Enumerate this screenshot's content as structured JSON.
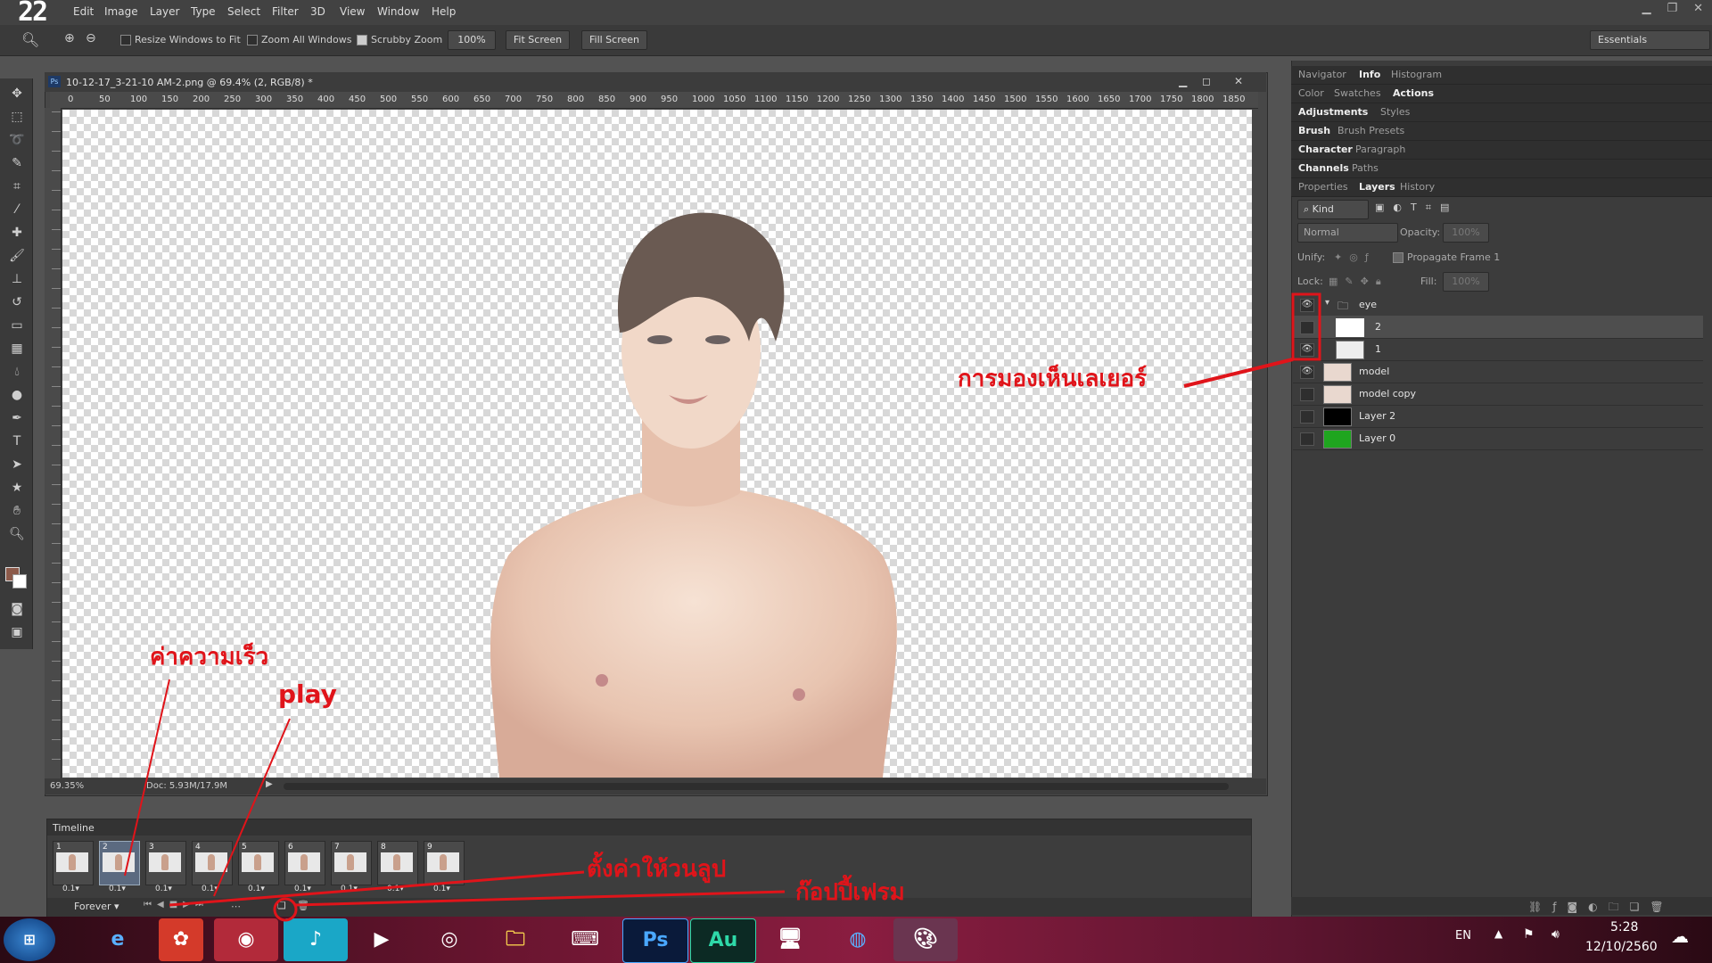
{
  "app": {
    "logo_text": "22",
    "menu": [
      "Edit",
      "Image",
      "Layer",
      "Type",
      "Select",
      "Filter",
      "3D",
      "View",
      "Window",
      "Help"
    ]
  },
  "options_bar": {
    "resize_windows": "Resize Windows to Fit",
    "zoom_all": "Zoom All Windows",
    "scrubby_zoom": "Scrubby Zoom",
    "zoom_value": "100%",
    "fit_screen": "Fit Screen",
    "fill_screen": "Fill Screen",
    "workspace": "Essentials"
  },
  "document": {
    "title": "10-12-17_3-21-10 AM-2.png @ 69.4% (2, RGB/8) *",
    "ruler_ticks": [
      "0",
      "50",
      "100",
      "150",
      "200",
      "250",
      "300",
      "350",
      "400",
      "450",
      "500",
      "550",
      "600",
      "650",
      "700",
      "750",
      "800",
      "850",
      "900",
      "950",
      "1000",
      "1050",
      "1100",
      "1150",
      "1200",
      "1250",
      "1300",
      "1350",
      "1400",
      "1450",
      "1500",
      "1550",
      "1600",
      "1650",
      "1700",
      "1750",
      "1800",
      "1850"
    ],
    "zoom": "69.35%",
    "doc_size": "Doc: 5.93M/17.9M"
  },
  "timeline": {
    "title": "Timeline",
    "loop": "Forever",
    "frames": [
      {
        "num": "1",
        "dur": "0.1"
      },
      {
        "num": "2",
        "dur": "0.1"
      },
      {
        "num": "3",
        "dur": "0.1"
      },
      {
        "num": "4",
        "dur": "0.1"
      },
      {
        "num": "5",
        "dur": "0.1"
      },
      {
        "num": "6",
        "dur": "0.1"
      },
      {
        "num": "7",
        "dur": "0.1"
      },
      {
        "num": "8",
        "dur": "0.1"
      },
      {
        "num": "9",
        "dur": "0.1"
      }
    ]
  },
  "panels": {
    "row1": [
      "Navigator",
      "Info",
      "Histogram"
    ],
    "row2": [
      "Color",
      "Swatches",
      "Actions"
    ],
    "row3": [
      "Adjustments",
      "Styles"
    ],
    "row4": [
      "Brush",
      "Brush Presets"
    ],
    "row5": [
      "Character",
      "Paragraph"
    ],
    "row6": [
      "Channels",
      "Paths"
    ],
    "row7": [
      "Properties",
      "Layers",
      "History"
    ]
  },
  "layers_panel": {
    "kind": "Kind",
    "blend": "Normal",
    "opacity_label": "Opacity:",
    "opacity": "100%",
    "unify": "Unify:",
    "propagate": "Propagate Frame 1",
    "lock": "Lock:",
    "fill_label": "Fill:",
    "fill": "100%",
    "layers": [
      {
        "name": "eye",
        "visible": true
      },
      {
        "name": "2",
        "visible": false
      },
      {
        "name": "1",
        "visible": true
      },
      {
        "name": "model",
        "visible": true
      },
      {
        "name": "model copy",
        "visible": false
      },
      {
        "name": "Layer 2",
        "visible": false
      },
      {
        "name": "Layer 0",
        "visible": false
      }
    ]
  },
  "annotations": {
    "visibility": "การมองเห็นเลเยอร์",
    "speed": "ค่าความเร็ว",
    "play": "play",
    "loop": "ตั้งค่าให้วนลูป",
    "copy_frame": "ก๊อปปี้เฟรม"
  },
  "taskbar": {
    "lang": "EN",
    "time": "5:28",
    "date": "12/10/2560",
    "apps": [
      "start",
      "ie",
      "app-red",
      "chrome",
      "music",
      "media",
      "browser",
      "folder",
      "keyboard",
      "Ps",
      "Au",
      "network",
      "messenger",
      "paint"
    ]
  }
}
